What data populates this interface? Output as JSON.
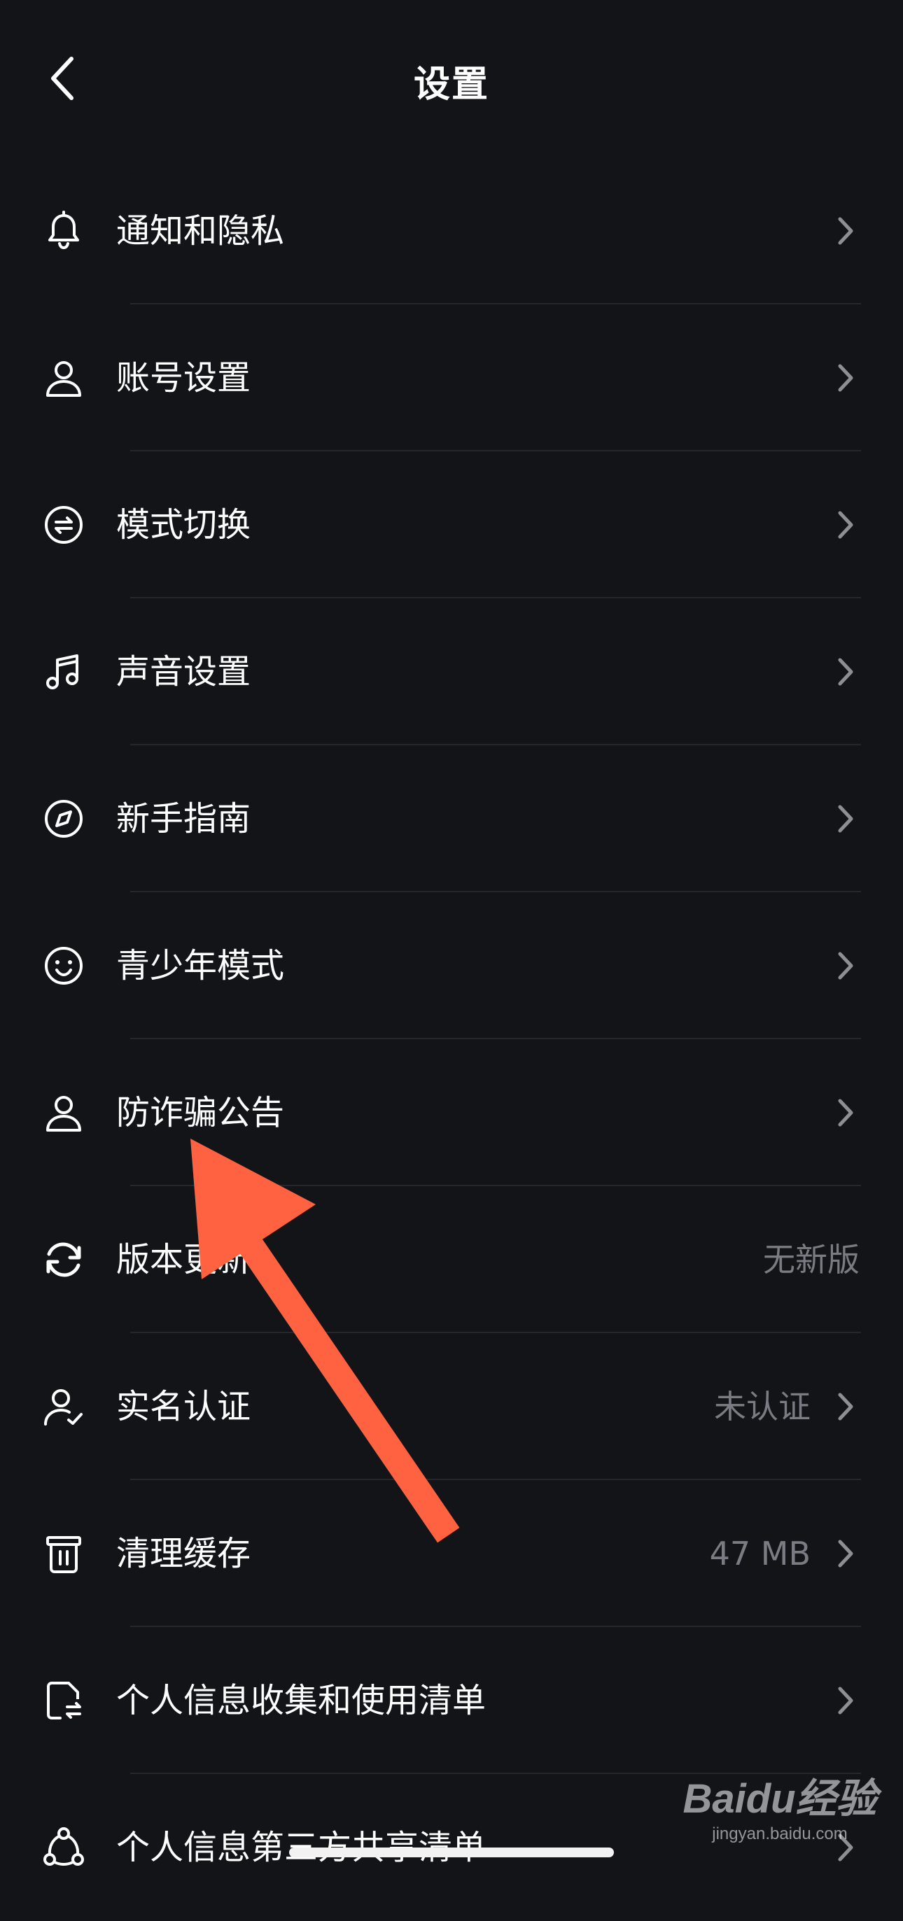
{
  "header": {
    "title": "设置",
    "back_icon": "chevron-left-icon"
  },
  "settings": [
    {
      "label": "通知和隐私",
      "icon": "bell-icon",
      "value": "",
      "chevron": true
    },
    {
      "label": "账号设置",
      "icon": "user-icon",
      "value": "",
      "chevron": true
    },
    {
      "label": "模式切换",
      "icon": "switch-mode-icon",
      "value": "",
      "chevron": true
    },
    {
      "label": "声音设置",
      "icon": "music-note-icon",
      "value": "",
      "chevron": true
    },
    {
      "label": "新手指南",
      "icon": "compass-icon",
      "value": "",
      "chevron": true
    },
    {
      "label": "青少年模式",
      "icon": "smiley-icon",
      "value": "",
      "chevron": true
    },
    {
      "label": "防诈骗公告",
      "icon": "user-icon",
      "value": "",
      "chevron": true
    },
    {
      "label": "版本更新",
      "icon": "refresh-icon",
      "value": "无新版",
      "chevron": false
    },
    {
      "label": "实名认证",
      "icon": "user-verified-icon",
      "value": "未认证",
      "chevron": true
    },
    {
      "label": "清理缓存",
      "icon": "trash-icon",
      "value": "47 MB",
      "chevron": true
    },
    {
      "label": "个人信息收集和使用清单",
      "icon": "document-exchange-icon",
      "value": "",
      "chevron": true
    },
    {
      "label": "个人信息第三方共享清单",
      "icon": "share-nodes-icon",
      "value": "",
      "chevron": true
    }
  ],
  "annotation": {
    "color": "#ff6240"
  },
  "watermark": {
    "brand": "Baidu经验",
    "url": "jingyan.baidu.com"
  },
  "theme": {
    "background": "#131418",
    "text": "#ffffff",
    "secondary_text": "#7b7c83",
    "divider": "#26272d",
    "chevron": "#8e8f95"
  }
}
